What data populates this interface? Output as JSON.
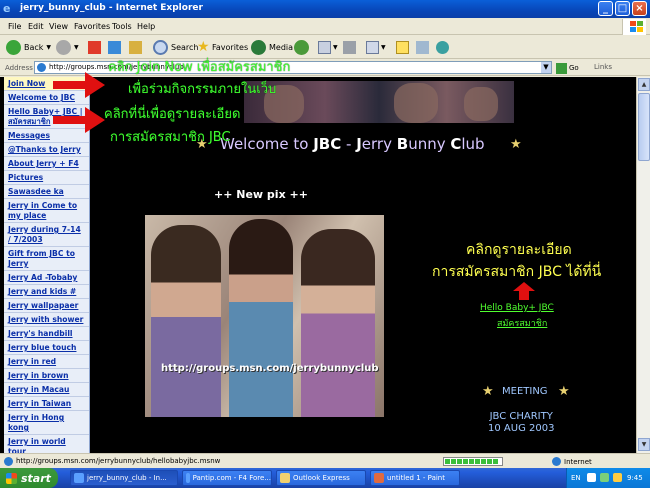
{
  "window": {
    "title": "jerry_bunny_club - Internet Explorer",
    "minimize": "_",
    "maximize": "□",
    "close": "×"
  },
  "menu": [
    "File",
    "Edit",
    "View",
    "Favorites",
    "Tools",
    "Help"
  ],
  "toolbar": {
    "back": "Back",
    "search": "Search",
    "favorites": "Favorites",
    "media": "Media"
  },
  "address": {
    "label": "Address",
    "url": "http://groups.msn.com/jerrybunnyclub",
    "go": "Go",
    "links": "Links"
  },
  "sidebar": {
    "items": [
      "Join Now",
      "Welcome to JBC",
      "Hello Baby+ JBC | สมัครสมาชิก",
      "Messages",
      "@Thanks to Jerry",
      "About Jerry + F4",
      "Pictures",
      "Sawasdee ka",
      "Jerry in Come to my place",
      "Jerry during 7-14 / 7/2003",
      "Gift from JBC to Jerry",
      "Jerry Ad -Tobaby",
      "Jerry and kids #",
      "Jerry wallpapaer",
      "Jerry with shower",
      "Jerry's handbill",
      "Jerry blue touch",
      "Jerry in red",
      "Jerry in brown",
      "Jerry in Macau",
      "Jerry in Taiwan",
      "Jerry in Hong kong",
      "Jerry in world tour"
    ]
  },
  "main": {
    "welcome_prefix": "Welcome to ",
    "welcome_jbc": "JBC",
    "welcome_dash": " - ",
    "welcome_j": "J",
    "welcome_erry": "erry ",
    "welcome_b": "B",
    "welcome_unny": "unny ",
    "welcome_c": "C",
    "welcome_lub": "lub",
    "new_pix": "++ New pix ++",
    "photo_watermark": "http://groups.msn.com/jerrybunnyclub",
    "info_line1": "คลิกดูรายละเอียด",
    "info_line2": "การสมัครสมาชิก JBC ได้ที่นี่",
    "hello_link_line1": "Hello Baby+ JBC",
    "hello_link_line2": "สมัครสมาชิก",
    "meeting": "MEETING",
    "charity_line1": "JBC CHARITY",
    "charity_line2": "10 AUG 2003"
  },
  "annotations": {
    "join_line1": "คลิก Join Now เพื่อสมัครสมาชิก",
    "join_line2": "เพื่อร่วมกิจกรรมภายในเว็บ",
    "detail_line1": "คลิกที่นี่เพื่อดูรายละเอียด",
    "detail_line2": "การสมัครสมาชิก JBC",
    "arrow_color": "#e01010",
    "text_color": "#40ff30"
  },
  "status": {
    "url": "http://groups.msn.com/jerrybunnyclub/hellobabyjbc.msnw",
    "zone": "Internet",
    "progress_fraction": 0.95
  },
  "taskbar": {
    "start": "start",
    "tasks": [
      "jerry_bunny_club - In...",
      "Pantip.com - F4 Fore...",
      "Outlook Express",
      "untitled 1 - Paint"
    ],
    "lang": "EN",
    "clock": "9:45"
  }
}
